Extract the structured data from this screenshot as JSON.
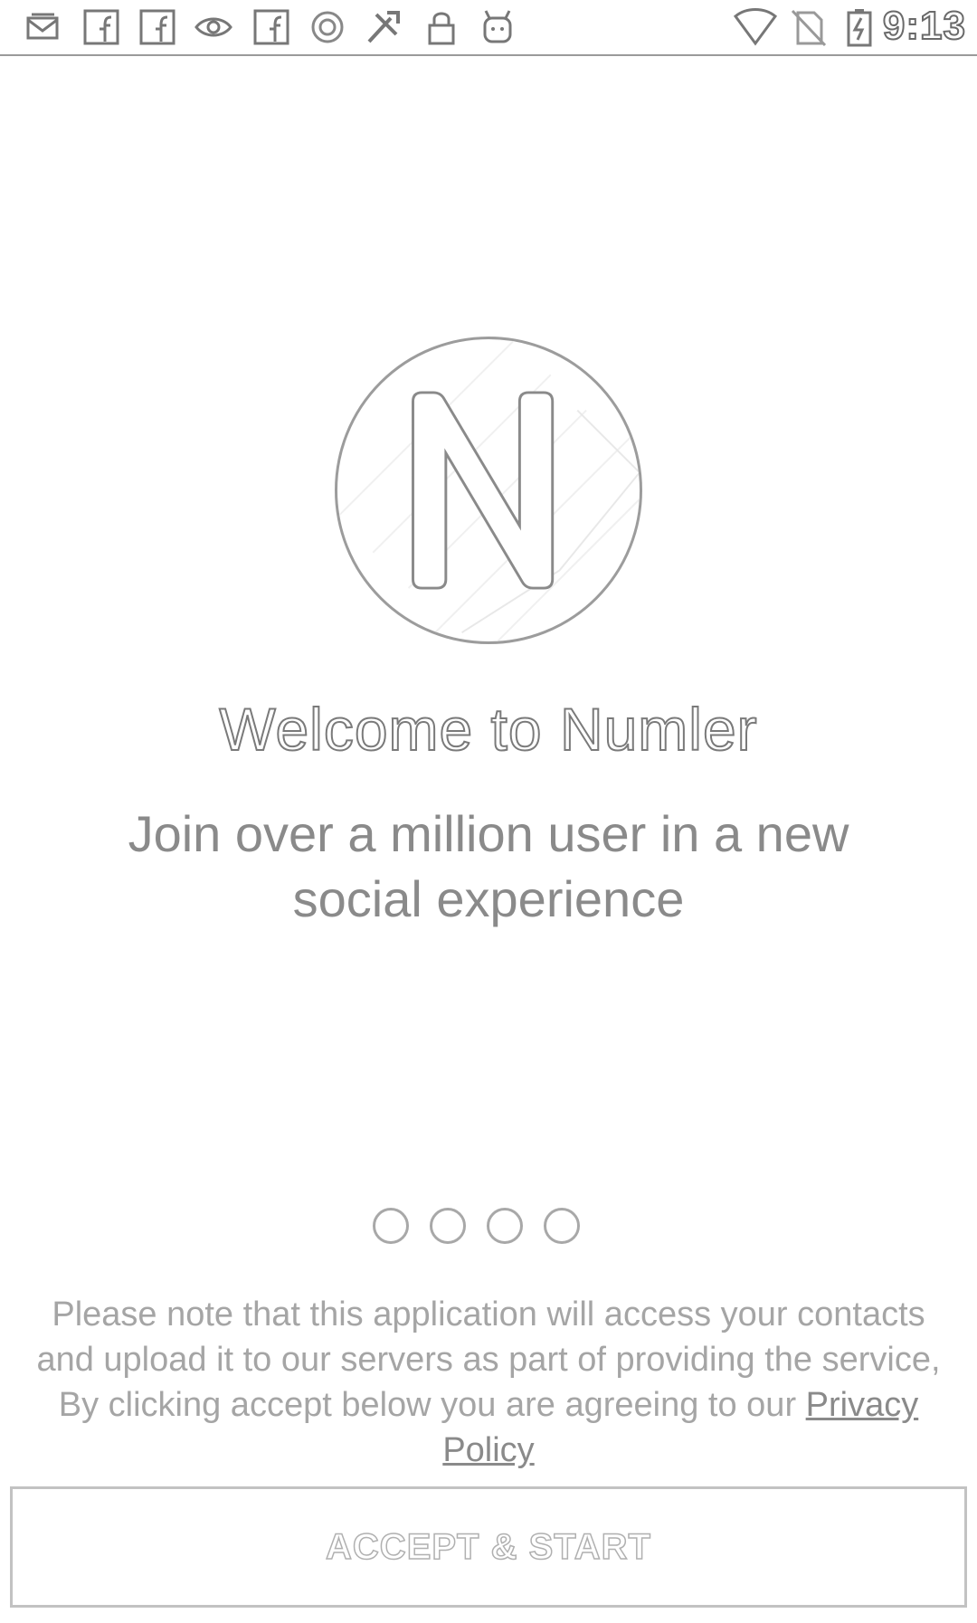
{
  "status_bar": {
    "time": "9:13",
    "left_icons": [
      "mail-icon",
      "facebook-icon",
      "facebook-icon",
      "eye-icon",
      "facebook-icon",
      "circle-app-icon",
      "tools-icon",
      "lock-icon",
      "android-icon"
    ],
    "right_icons": [
      "wifi-icon",
      "no-sim-icon",
      "battery-charging-icon"
    ]
  },
  "logo": {
    "letter": "N"
  },
  "welcome": {
    "title": "Welcome to Numler",
    "subtitle": "Join over a million user in a new social experience"
  },
  "pager": {
    "count": 4
  },
  "notice": {
    "text": "Please note that this application will access your contacts and upload it to our servers as part of providing the service, By clicking accept below you are agreeing to our ",
    "link": "Privacy Policy"
  },
  "accept_button": {
    "label": "ACCEPT & START"
  }
}
